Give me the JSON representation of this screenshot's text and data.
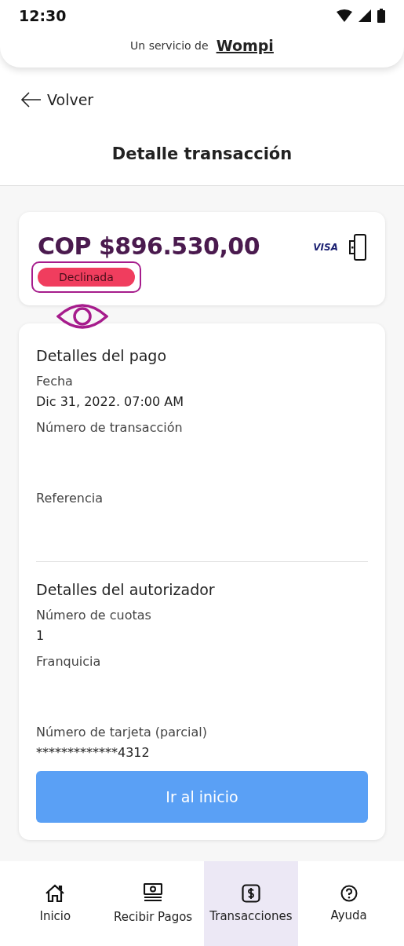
{
  "status_bar": {
    "time": "12:30"
  },
  "header": {
    "service_text": "Un servicio de",
    "brand": "Wompi"
  },
  "back_link": {
    "label": "Volver"
  },
  "page_title": "Detalle transacción",
  "summary": {
    "amount": "COP $896.530,00",
    "card_brand": "VISA",
    "status": "Declinada",
    "status_highlighted": true
  },
  "sections": [
    {
      "title": "Detalles del pago",
      "fields": [
        {
          "label": "Fecha",
          "value": "Dic 31, 2022. 07:00 AM"
        },
        {
          "label": "Número de transacción"
        },
        {
          "label": "Referencia"
        }
      ]
    },
    {
      "title": "Detalles del autorizador",
      "fields": [
        {
          "label": "Número de cuotas",
          "value": "1"
        },
        {
          "label": "Franquicia"
        },
        {
          "label": "Número de tarjeta (parcial)",
          "value": "*************4312"
        }
      ]
    }
  ],
  "primary_button": "Ir al inicio",
  "bottom_nav": [
    {
      "label": "Inicio",
      "kind": "home",
      "selected": false
    },
    {
      "label": "Recibir Pagos",
      "kind": "cash",
      "selected": false
    },
    {
      "label": "Transacciones",
      "kind": "dollar",
      "selected": true
    },
    {
      "label": "Ayuda",
      "kind": "help",
      "selected": false
    }
  ]
}
